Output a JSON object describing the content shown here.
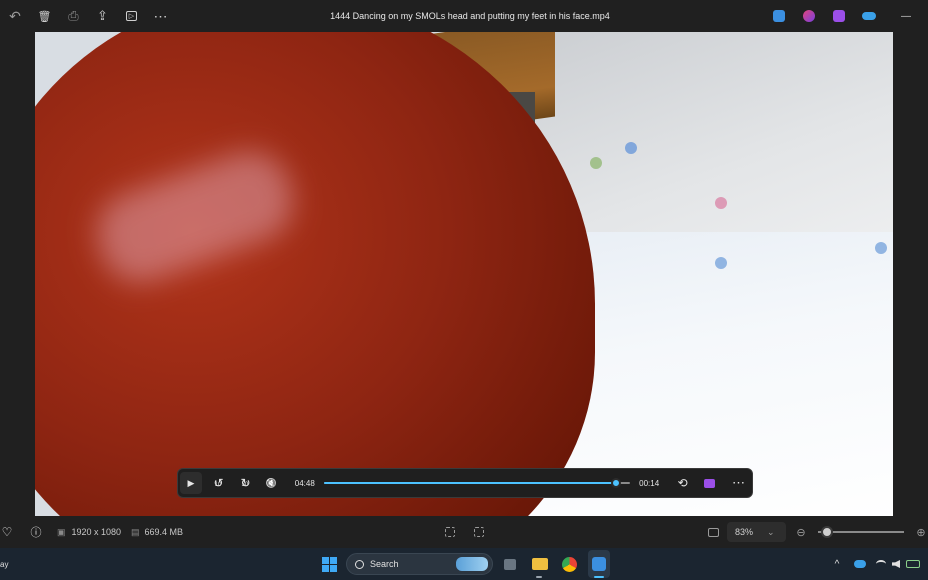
{
  "window": {
    "title": "1444 Dancing on my SMOLs head and putting my feet in his face.mp4"
  },
  "toolbar_left": [
    {
      "name": "rotate-icon",
      "glyph": "↶"
    },
    {
      "name": "delete-icon",
      "glyph": "🗑"
    },
    {
      "name": "print-icon",
      "glyph": "⎙"
    },
    {
      "name": "share-icon",
      "glyph": "⇪"
    },
    {
      "name": "slideshow-icon",
      "glyph": "▷"
    },
    {
      "name": "more-icon",
      "glyph": "⋯"
    }
  ],
  "toolbar_right_apps": [
    {
      "name": "edit-app-icon",
      "color": "#3b8fe0"
    },
    {
      "name": "designer-app-icon",
      "color": "#7a3fe0"
    },
    {
      "name": "clipchamp-app-icon",
      "color": "#9b4fe8"
    },
    {
      "name": "onedrive-icon",
      "color": "#3aa0e8"
    }
  ],
  "window_controls": {
    "minimize_glyph": "—"
  },
  "player": {
    "play_glyph": "▶",
    "rewind_glyph": "↺",
    "rewind_label": "10",
    "forward_glyph": "↻",
    "forward_label": "30",
    "mute_glyph": "🔇",
    "elapsed": "04:48",
    "remaining": "00:14",
    "progress": 0.955,
    "repeat_glyph": "⟲",
    "more_glyph": "⋯",
    "accent": "#4cc2ff"
  },
  "infobar": {
    "favorite_glyph": "♡",
    "info_glyph": "ⓘ",
    "resolution_icon_glyph": "▣",
    "resolution": "1920 x 1080",
    "size_icon_glyph": "▤",
    "file_size": "669.4 MB",
    "zoom": "83%",
    "zoom_chevron": "⌄",
    "zoom_out_glyph": "⊖",
    "zoom_in_glyph": "⊕",
    "zoom_level": 0.1
  },
  "taskbar": {
    "left_partial_text": "ay",
    "search_placeholder": "Search",
    "tray_time_glyph": "^"
  }
}
